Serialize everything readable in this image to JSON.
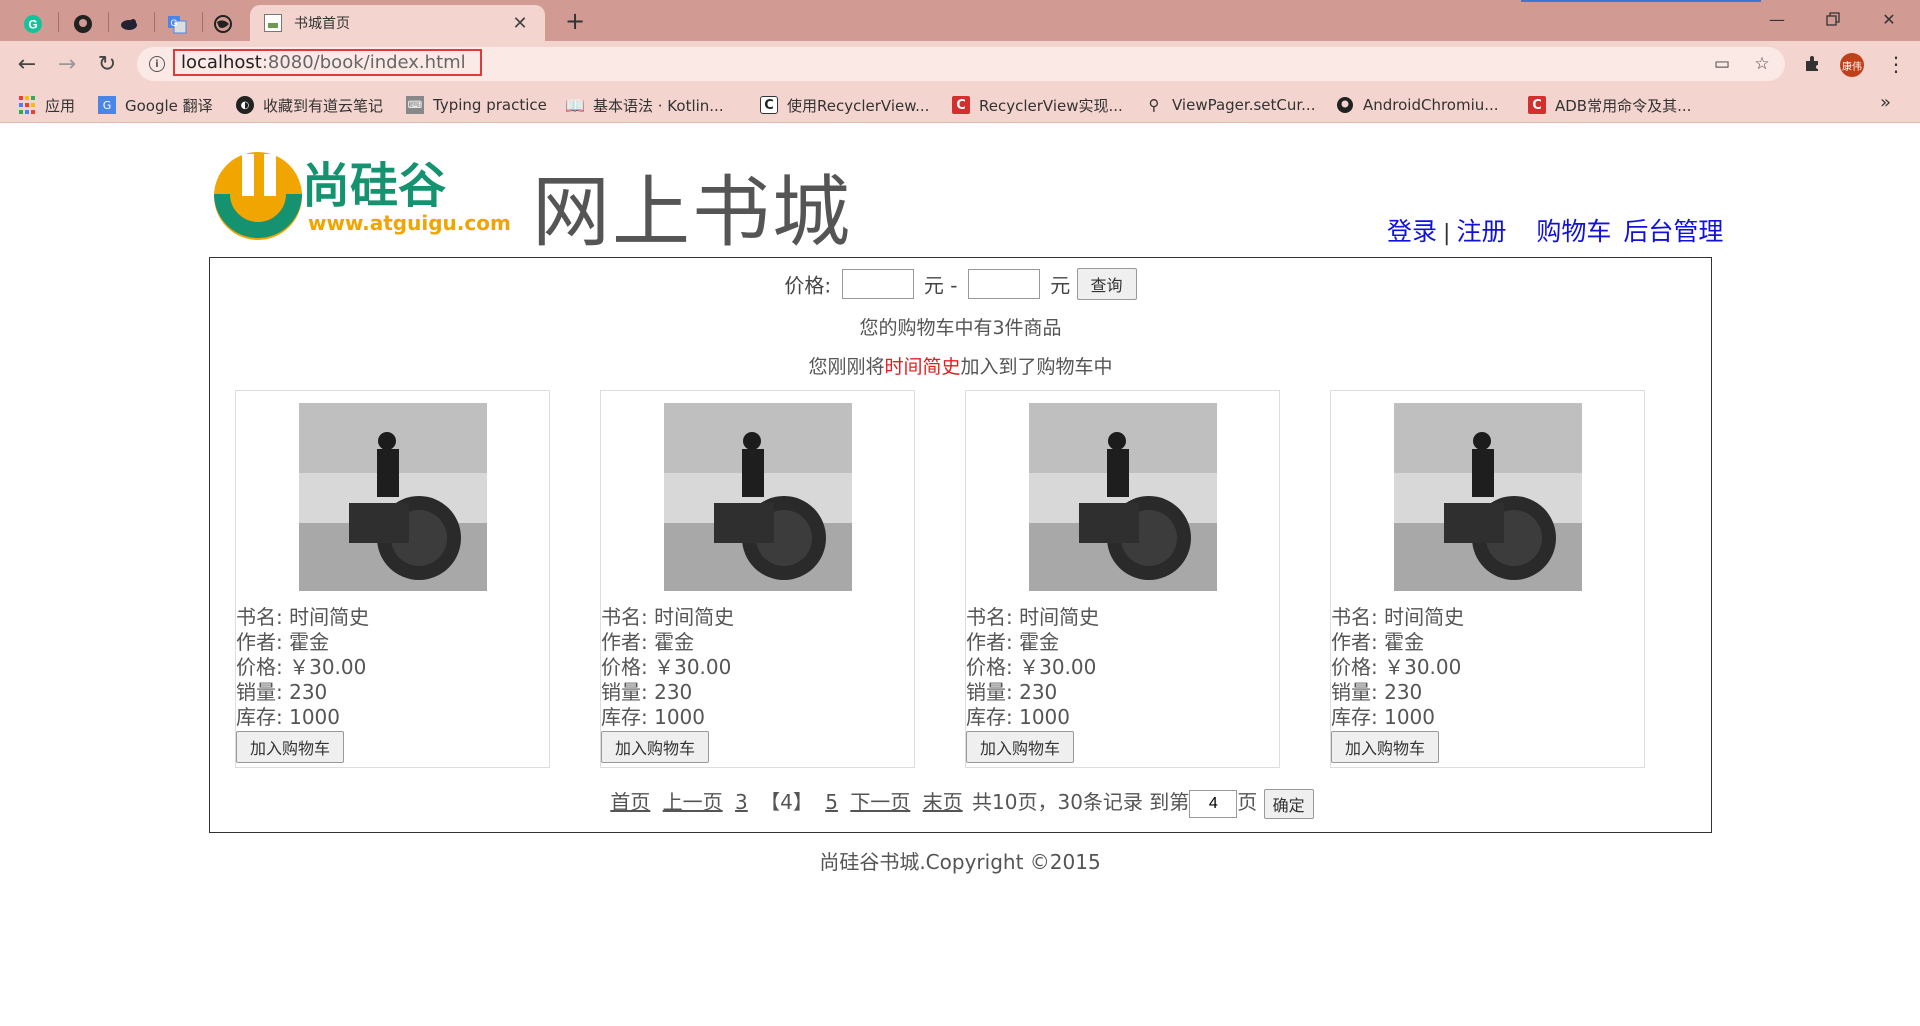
{
  "browser": {
    "tab_title": "书城首页",
    "url_host": "localhost",
    "url_rest": ":8080/book/index.html",
    "avatar_text": "康伟",
    "bookmarks": [
      {
        "label": "应用",
        "icon": "apps-grid-icon"
      },
      {
        "label": "Google 翻译",
        "icon": "google-translate-icon"
      },
      {
        "label": "收藏到有道云笔记",
        "icon": "youdao-note-icon"
      },
      {
        "label": "Typing practice",
        "icon": "keyboard-icon"
      },
      {
        "label": "基本语法 · Kotlin...",
        "icon": "book-icon"
      },
      {
        "label": "使用RecyclerView...",
        "icon": "csdn-icon"
      },
      {
        "label": "RecyclerView实现...",
        "icon": "csdn-red-icon"
      },
      {
        "label": "ViewPager.setCur...",
        "icon": "figure-icon"
      },
      {
        "label": "AndroidChromiu...",
        "icon": "github-icon"
      },
      {
        "label": "ADB常用命令及其...",
        "icon": "csdn-red-icon"
      }
    ]
  },
  "header": {
    "logo_text": "尚硅谷",
    "logo_sub": "www.atguigu.com",
    "title": "网上书城",
    "links": {
      "login": "登录",
      "sep": "|",
      "register": "注册",
      "cart": "购物车",
      "admin": "后台管理"
    }
  },
  "search": {
    "price_label": "价格:",
    "yuan_dash": "元 -",
    "yuan": "元",
    "query_button": "查询"
  },
  "messages": {
    "cart_count": "您的购物车中有3件商品",
    "added_prefix": "您刚刚将",
    "added_book": "时间简史",
    "added_suffix": "加入到了购物车中"
  },
  "books": [
    {
      "name": "书名: 时间简史",
      "author": "作者: 霍金",
      "price": "价格: ￥30.00",
      "sales": "销量: 230",
      "stock": "库存: 1000",
      "button": "加入购物车"
    },
    {
      "name": "书名: 时间简史",
      "author": "作者: 霍金",
      "price": "价格: ￥30.00",
      "sales": "销量: 230",
      "stock": "库存: 1000",
      "button": "加入购物车"
    },
    {
      "name": "书名: 时间简史",
      "author": "作者: 霍金",
      "price": "价格: ￥30.00",
      "sales": "销量: 230",
      "stock": "库存: 1000",
      "button": "加入购物车"
    },
    {
      "name": "书名: 时间简史",
      "author": "作者: 霍金",
      "price": "价格: ￥30.00",
      "sales": "销量: 230",
      "stock": "库存: 1000",
      "button": "加入购物车"
    }
  ],
  "pager": {
    "first": "首页",
    "prev": "上一页",
    "page_prev": "3",
    "page_current": "【4】",
    "page_next": "5",
    "next": "下一页",
    "last": "末页",
    "summary": "共10页，30条记录 到第",
    "goto_value": "4",
    "page_unit": "页",
    "confirm": "确定"
  },
  "footer": {
    "copyright": "尚硅谷书城.Copyright ©2015"
  }
}
